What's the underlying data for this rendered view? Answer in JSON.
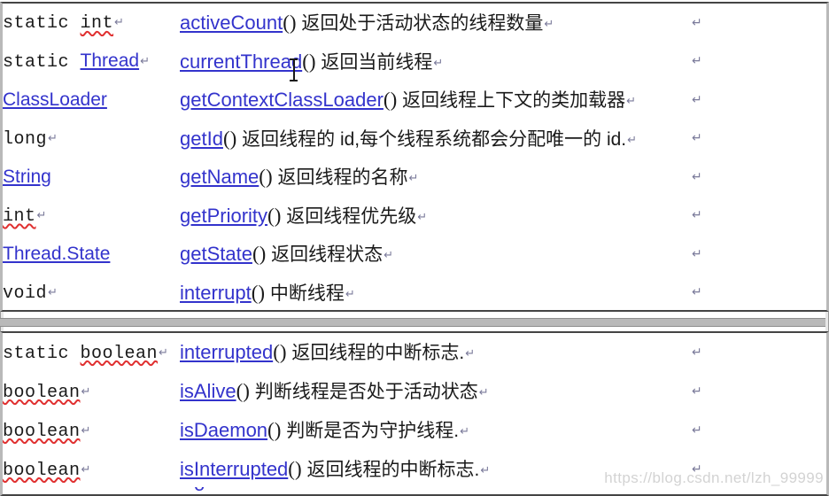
{
  "document": {
    "kind": "word-processor-document",
    "watermark": "https://blog.csdn.net/lzh_99999",
    "pilcrow_glyph": "↵",
    "colors": {
      "hyperlink": "#3333cc",
      "body_text": "#1a1a1a",
      "spellcheck_underline": "#e03030",
      "page_border": "#444444",
      "page_break_bar": "#b9b9b9",
      "watermark": "#d3d3d3"
    }
  },
  "blocks": [
    {
      "id": "thread-methods-page-1",
      "rows": [
        {
          "type_modifier": "static ",
          "type_name": "int",
          "type_is_link": false,
          "type_misspelled": true,
          "type_pilcrow": "↵",
          "method": "activeCount",
          "parens": "()",
          "description": "返回处于活动状态的线程数量",
          "description_pilcrow": "↵",
          "row_pilcrow": "↵"
        },
        {
          "type_modifier": "static ",
          "type_name": "Thread",
          "type_is_link": true,
          "type_misspelled": false,
          "type_pilcrow": "↵",
          "method": "currentThread",
          "parens": "()",
          "description": "返回当前线程",
          "description_pilcrow": "↵",
          "row_pilcrow": "↵"
        },
        {
          "type_modifier": "",
          "type_name": "ClassLoader",
          "type_is_link": true,
          "type_misspelled": false,
          "type_pilcrow": "",
          "method": "getContextClassLoader",
          "parens": "()",
          "description": "返回线程上下文的类加载器",
          "description_pilcrow": "↵",
          "row_pilcrow": "↵"
        },
        {
          "type_modifier": "",
          "type_name": "long",
          "type_is_link": false,
          "type_misspelled": false,
          "type_pilcrow": "↵",
          "method": "getId",
          "parens": "()",
          "description": "返回线程的 id,每个线程系统都会分配唯一的 id.",
          "description_pilcrow": "↵",
          "row_pilcrow": "↵"
        },
        {
          "type_modifier": "",
          "type_name": "String",
          "type_is_link": true,
          "type_misspelled": false,
          "type_pilcrow": "",
          "method": "getName",
          "parens": "()",
          "description": "返回线程的名称",
          "description_pilcrow": "↵",
          "row_pilcrow": "↵"
        },
        {
          "type_modifier": "",
          "type_name": "int",
          "type_is_link": false,
          "type_misspelled": true,
          "type_pilcrow": "↵",
          "method": "getPriority",
          "parens": "()",
          "description": "返回线程优先级",
          "description_pilcrow": "↵",
          "row_pilcrow": "↵"
        },
        {
          "type_modifier": "",
          "type_name": "Thread.State",
          "type_is_link": true,
          "type_misspelled": false,
          "type_pilcrow": "",
          "method": "getState",
          "parens": "()",
          "description": "返回线程状态",
          "description_pilcrow": "↵",
          "row_pilcrow": "↵"
        },
        {
          "type_modifier": "",
          "type_name": "void",
          "type_is_link": false,
          "type_misspelled": false,
          "type_pilcrow": "↵",
          "method": "interrupt",
          "parens": "()",
          "description": "中断线程",
          "description_pilcrow": "↵",
          "row_pilcrow": "↵"
        }
      ]
    },
    {
      "id": "thread-methods-page-2",
      "rows": [
        {
          "type_modifier": "static ",
          "type_name": "boolean",
          "type_is_link": false,
          "type_misspelled": true,
          "type_pilcrow": "↵",
          "method": "interrupted",
          "parens": "()",
          "description": "返回线程的中断标志.",
          "description_pilcrow": "↵",
          "row_pilcrow": "↵"
        },
        {
          "type_modifier": "",
          "type_name": "boolean",
          "type_is_link": false,
          "type_misspelled": true,
          "type_pilcrow": "↵",
          "method": "isAlive",
          "parens": "()",
          "description": "判断线程是否处于活动状态",
          "description_pilcrow": "↵",
          "row_pilcrow": "↵"
        },
        {
          "type_modifier": "",
          "type_name": "boolean",
          "type_is_link": false,
          "type_misspelled": true,
          "type_pilcrow": "↵",
          "method": "isDaemon",
          "parens": "()",
          "description": "判断是否为守护线程.",
          "description_pilcrow": "↵",
          "row_pilcrow": "↵"
        },
        {
          "type_modifier": "",
          "type_name": "boolean",
          "type_is_link": false,
          "type_misspelled": true,
          "type_pilcrow": "↵",
          "method": "isInterrupted",
          "parens": "()",
          "description": "返回线程的中断标志.",
          "description_pilcrow": "↵",
          "row_pilcrow": "↵"
        }
      ]
    }
  ]
}
